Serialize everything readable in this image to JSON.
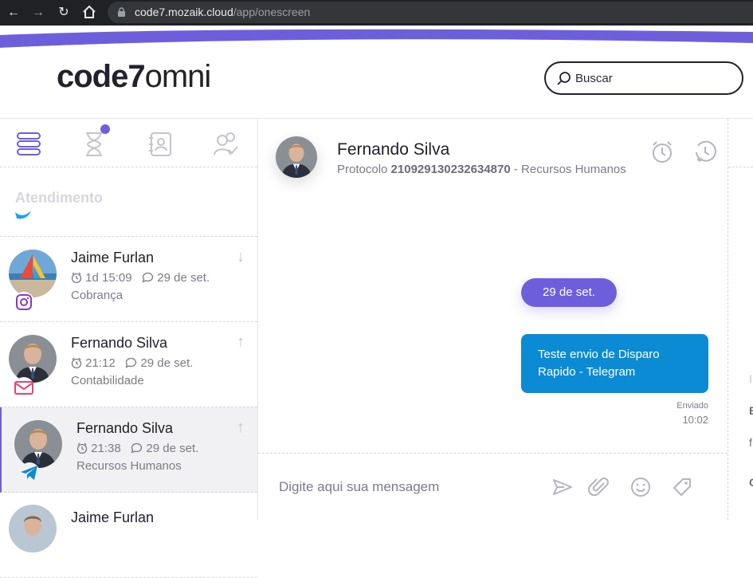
{
  "browser": {
    "url_domain": "code7.mozaik.cloud",
    "url_path": "/app/onescreen"
  },
  "header": {
    "logo_bold": "code7",
    "logo_light": "omni",
    "search_placeholder": "Buscar"
  },
  "sidebar": {
    "section_title": "Atendimento",
    "conversations": [
      {
        "name": "Jaime Furlan",
        "time": "1d 15:09",
        "date": "29 de set.",
        "department": "Cobrança",
        "channel_icon": "instagram-icon",
        "arrow": "↓"
      },
      {
        "name": "Fernando Silva",
        "time": "21:12",
        "date": "29 de set.",
        "department": "Contabilidade",
        "channel_icon": "email-icon",
        "arrow": "↑"
      },
      {
        "name": "Fernando Silva",
        "time": "21:38",
        "date": "29 de set.",
        "department": "Recursos Humanos",
        "channel_icon": "telegram-icon",
        "arrow": "↑"
      },
      {
        "name": "Jaime Furlan"
      }
    ]
  },
  "chat": {
    "contact_name": "Fernando Silva",
    "protocol_label": "Protocolo",
    "protocol_number": "210929130232634870",
    "protocol_dept": "- Recursos Humanos",
    "date_separator": "29 de set.",
    "message_text": "Teste envio de Disparo Rapido - Telegram",
    "message_status": "Enviado",
    "message_time": "10:02",
    "composer_placeholder": "Digite aqui sua mensagem"
  },
  "right_panel": {
    "letters": [
      "I",
      "E",
      "f",
      "C"
    ]
  },
  "colors": {
    "accent": "#6d5fdc",
    "bubble": "#0a8bd4",
    "instagram": "#8a3ab9",
    "email": "#e0457b",
    "telegram": "#0a8bd4"
  }
}
